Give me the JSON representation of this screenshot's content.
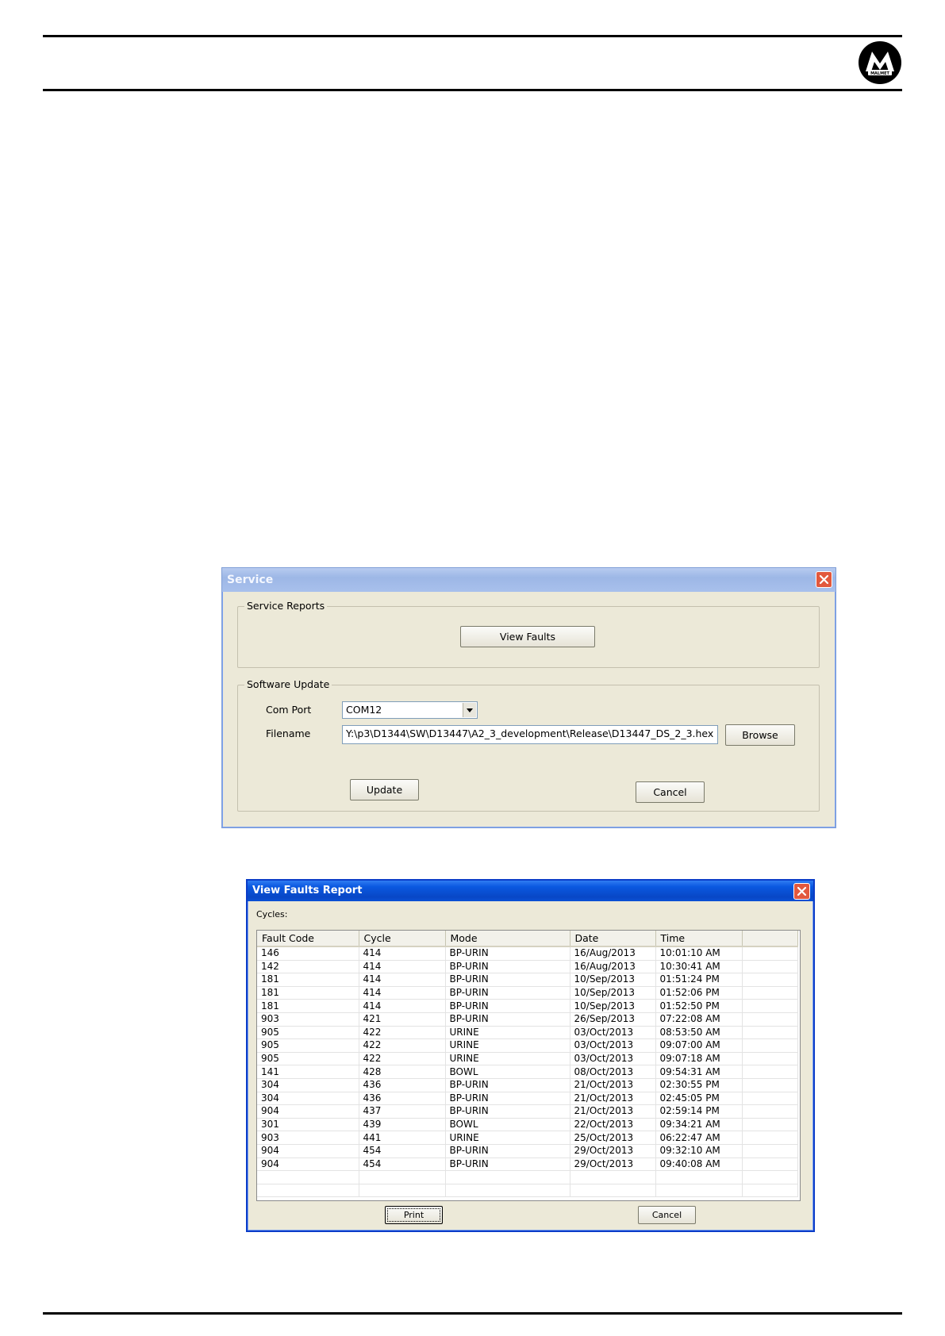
{
  "header": {
    "logo_text": "MALMET"
  },
  "service_dialog": {
    "title": "Service",
    "service_reports_label": "Service Reports",
    "view_faults_label": "View Faults",
    "software_update_label": "Software Update",
    "com_port_label": "Com Port",
    "com_port_value": "COM12",
    "filename_label": "Filename",
    "filename_value": "Y:\\p3\\D1344\\SW\\D13447\\A2_3_development\\Release\\D13447_DS_2_3.hex",
    "browse_label": "Browse",
    "update_label": "Update",
    "cancel_label": "Cancel"
  },
  "faults_dialog": {
    "title": "View Faults Report",
    "cycles_label": "Cycles:",
    "columns": [
      "Fault Code",
      "Cycle",
      "Mode",
      "Date",
      "Time",
      ""
    ],
    "rows": [
      [
        "146",
        "414",
        "BP-URIN",
        "16/Aug/2013",
        "10:01:10 AM"
      ],
      [
        "142",
        "414",
        "BP-URIN",
        "16/Aug/2013",
        "10:30:41 AM"
      ],
      [
        "181",
        "414",
        "BP-URIN",
        "10/Sep/2013",
        "01:51:24 PM"
      ],
      [
        "181",
        "414",
        "BP-URIN",
        "10/Sep/2013",
        "01:52:06 PM"
      ],
      [
        "181",
        "414",
        "BP-URIN",
        "10/Sep/2013",
        "01:52:50 PM"
      ],
      [
        "903",
        "421",
        "BP-URIN",
        "26/Sep/2013",
        "07:22:08 AM"
      ],
      [
        "905",
        "422",
        "URINE",
        "03/Oct/2013",
        "08:53:50 AM"
      ],
      [
        "905",
        "422",
        "URINE",
        "03/Oct/2013",
        "09:07:00 AM"
      ],
      [
        "905",
        "422",
        "URINE",
        "03/Oct/2013",
        "09:07:18 AM"
      ],
      [
        "141",
        "428",
        "BOWL",
        "08/Oct/2013",
        "09:54:31 AM"
      ],
      [
        "304",
        "436",
        "BP-URIN",
        "21/Oct/2013",
        "02:30:55 PM"
      ],
      [
        "304",
        "436",
        "BP-URIN",
        "21/Oct/2013",
        "02:45:05 PM"
      ],
      [
        "904",
        "437",
        "BP-URIN",
        "21/Oct/2013",
        "02:59:14 PM"
      ],
      [
        "301",
        "439",
        "BOWL",
        "22/Oct/2013",
        "09:34:21 AM"
      ],
      [
        "903",
        "441",
        "URINE",
        "25/Oct/2013",
        "06:22:47 AM"
      ],
      [
        "904",
        "454",
        "BP-URIN",
        "29/Oct/2013",
        "09:32:10 AM"
      ],
      [
        "904",
        "454",
        "BP-URIN",
        "29/Oct/2013",
        "09:40:08 AM"
      ]
    ],
    "print_label": "Print",
    "cancel_label": "Cancel"
  },
  "colors": {
    "xp_title_blue": "#0a55d8",
    "dialog_face": "#ece9d8",
    "inactive_title": "#a4bde8"
  }
}
